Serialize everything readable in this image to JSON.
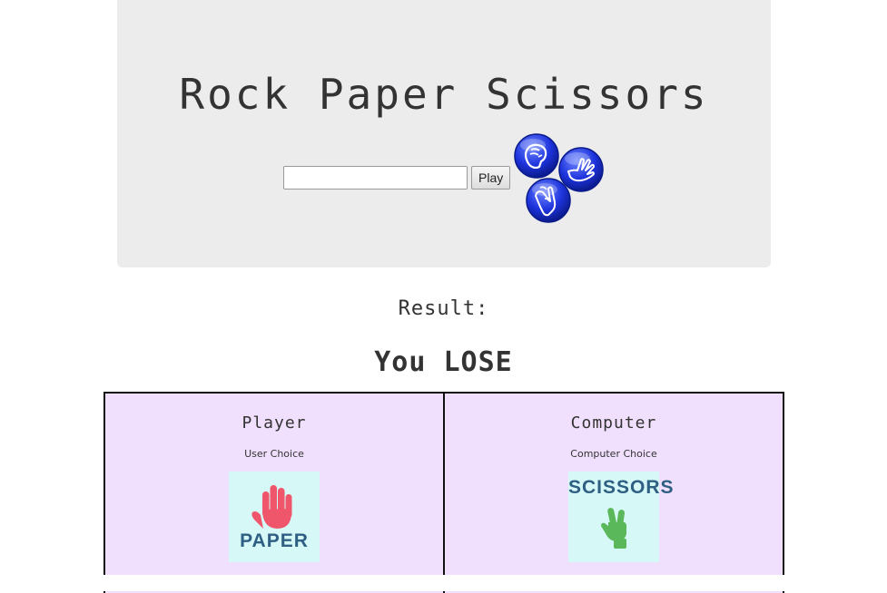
{
  "hero": {
    "title": "Rock Paper Scissors",
    "input_value": "",
    "input_placeholder": "",
    "play_label": "Play",
    "icons": [
      "rock-fist-icon",
      "paper-hand-icon",
      "scissors-hand-icon"
    ],
    "icon_color": "#1a2fd6"
  },
  "result": {
    "label": "Result:",
    "outcome": "You LOSE"
  },
  "board": {
    "player": {
      "title": "Player",
      "subtitle": "User Choice",
      "choice": "PAPER",
      "icon": "paper-hand-icon",
      "hand_color": "#f0566b"
    },
    "computer": {
      "title": "Computer",
      "subtitle": "Computer Choice",
      "choice": "SCISSORS",
      "icon": "scissors-hand-icon",
      "hand_color": "#5bb85a"
    }
  },
  "colors": {
    "hero_bg": "#ececec",
    "board_bg": "#f1e0fd",
    "card_bg": "#d6f8f7",
    "caption_text": "#2f5f82"
  }
}
